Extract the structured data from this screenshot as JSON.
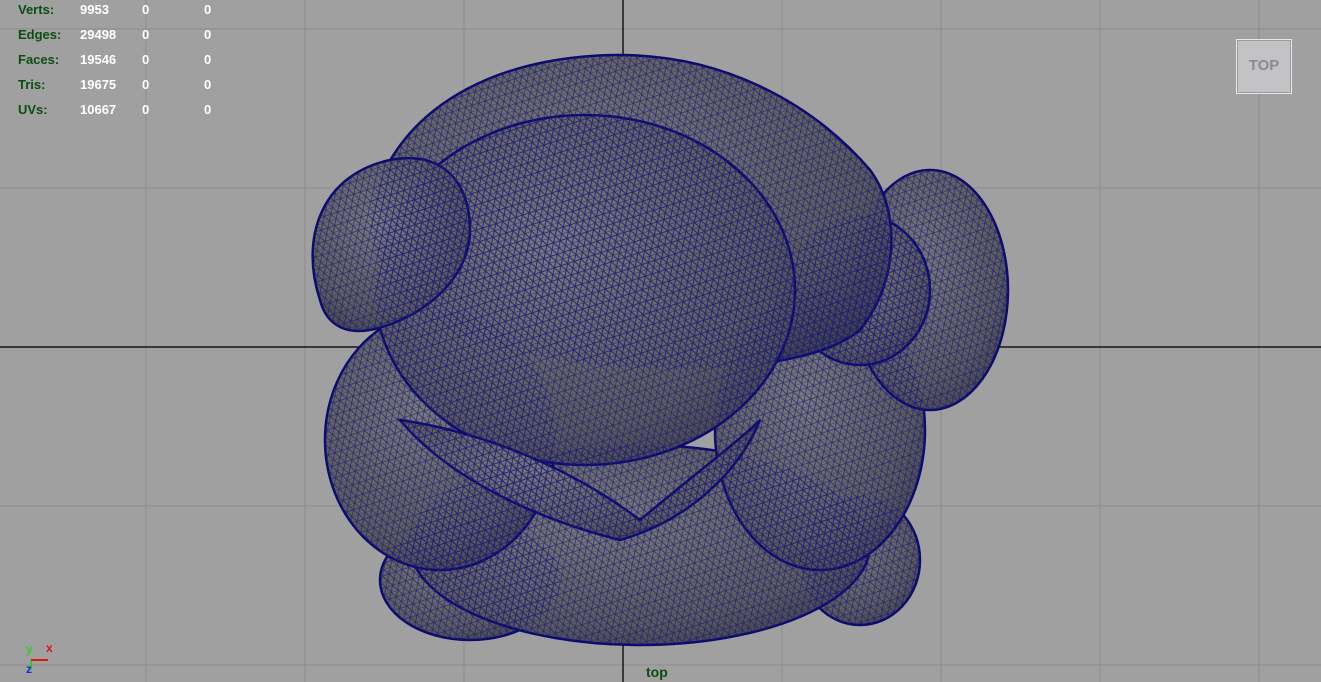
{
  "hud": {
    "rows": [
      {
        "label": "Verts:",
        "values": [
          "9953",
          "0",
          "0"
        ]
      },
      {
        "label": "Edges:",
        "values": [
          "29498",
          "0",
          "0"
        ]
      },
      {
        "label": "Faces:",
        "values": [
          "19546",
          "0",
          "0"
        ]
      },
      {
        "label": "Tris:",
        "values": [
          "19675",
          "0",
          "0"
        ]
      },
      {
        "label": "UVs:",
        "values": [
          "10667",
          "0",
          "0"
        ]
      }
    ]
  },
  "viewcube": {
    "label": "TOP"
  },
  "camera_label": "top",
  "axis": {
    "y": "y",
    "x": "x",
    "z": "z"
  },
  "colors": {
    "background": "#a0a0a0",
    "grid": "#8a8a8a",
    "axis_lines": "#111111",
    "wire": "#0b0b6e",
    "surface": "#6e6e6e",
    "hud_label": "#0d4d12",
    "hud_value": "#ffffff",
    "axis_y": "#2cd12c",
    "axis_x": "#e01515",
    "axis_z": "#1a2ae0"
  },
  "icons": [
    "viewcube-icon",
    "axis-gizmo-icon"
  ]
}
